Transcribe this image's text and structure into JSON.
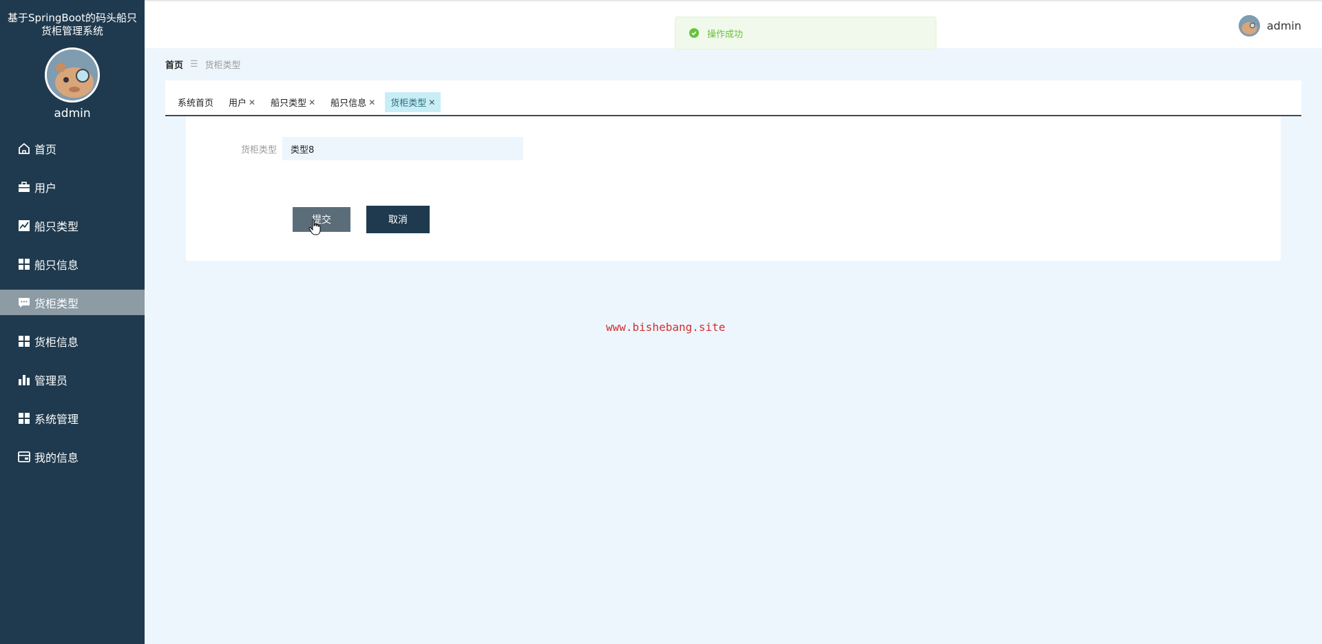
{
  "sidebar": {
    "title": "基于SpringBoot的码头船只货柜管理系统",
    "username": "admin",
    "items": [
      {
        "label": "首页",
        "icon": "home-icon"
      },
      {
        "label": "用户",
        "icon": "briefcase-icon"
      },
      {
        "label": "船只类型",
        "icon": "line-chart-icon"
      },
      {
        "label": "船只信息",
        "icon": "grid-icon"
      },
      {
        "label": "货柜类型",
        "icon": "chat-icon",
        "active": true
      },
      {
        "label": "货柜信息",
        "icon": "grid-icon"
      },
      {
        "label": "管理员",
        "icon": "bar-chart-icon"
      },
      {
        "label": "系统管理",
        "icon": "grid-icon"
      },
      {
        "label": "我的信息",
        "icon": "wallet-icon"
      }
    ]
  },
  "header": {
    "toast": "操作成功",
    "username": "admin"
  },
  "breadcrumb": {
    "home": "首页",
    "separator": "☰",
    "current": "货柜类型"
  },
  "tabs": [
    {
      "label": "系统首页",
      "closable": false
    },
    {
      "label": "用户",
      "closable": true
    },
    {
      "label": "船只类型",
      "closable": true
    },
    {
      "label": "船只信息",
      "closable": true
    },
    {
      "label": "货柜类型",
      "closable": true,
      "active": true
    }
  ],
  "form": {
    "label": "货柜类型",
    "value": "类型8",
    "submit": "提交",
    "cancel": "取消"
  },
  "watermark": "www.bishebang.site",
  "colors": {
    "sidebar": "#1f3a4e",
    "active_menu": "#8c9ba4",
    "toast_text": "#67c23a",
    "watermark": "#d0302f"
  }
}
